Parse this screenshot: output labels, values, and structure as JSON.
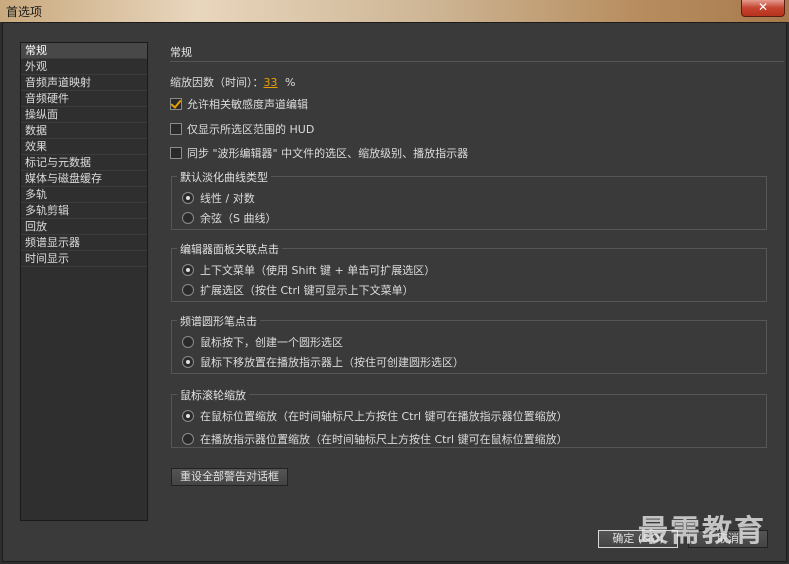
{
  "window": {
    "title": "首选项",
    "close_glyph": "✕"
  },
  "sidebar": {
    "items": [
      {
        "label": "常规"
      },
      {
        "label": "外观"
      },
      {
        "label": "音频声道映射"
      },
      {
        "label": "音频硬件"
      },
      {
        "label": "操纵面"
      },
      {
        "label": "数据"
      },
      {
        "label": "效果"
      },
      {
        "label": "标记与元数据"
      },
      {
        "label": "媒体与磁盘缓存"
      },
      {
        "label": "多轨"
      },
      {
        "label": "多轨剪辑"
      },
      {
        "label": "回放"
      },
      {
        "label": "频谱显示器"
      },
      {
        "label": "时间显示"
      }
    ],
    "selected_index": 0
  },
  "general": {
    "title": "常规",
    "zoom_label": "缩放因数（时间）：",
    "zoom_value": "33",
    "zoom_unit": "%",
    "checkboxes": [
      {
        "label": "允许相关敏感度声道编辑",
        "checked": true
      },
      {
        "label": "仅显示所选区范围的 HUD",
        "checked": false
      },
      {
        "label": "同步 \"波形编辑器\" 中文件的选区、缩放级别、播放指示器",
        "checked": false
      }
    ]
  },
  "groups": {
    "fade": {
      "title": "默认淡化曲线类型",
      "options": [
        {
          "label": "线性 / 对数",
          "checked": true
        },
        {
          "label": "余弦（S 曲线）",
          "checked": false
        }
      ]
    },
    "editor_click": {
      "title": "编辑器面板关联点击",
      "options": [
        {
          "label": "上下文菜单（使用 Shift 键 + 单击可扩展选区）",
          "checked": true
        },
        {
          "label": "扩展选区（按住 Ctrl 键可显示上下文菜单）",
          "checked": false
        }
      ]
    },
    "spectral_pen": {
      "title": "频谱圆形笔点击",
      "options": [
        {
          "label": "鼠标按下，创建一个圆形选区",
          "checked": false
        },
        {
          "label": "鼠标下移放置在播放指示器上（按住可创建圆形选区）",
          "checked": true
        }
      ]
    },
    "mouse_wheel": {
      "title": "鼠标滚轮缩放",
      "options": [
        {
          "label": "在鼠标位置缩放（在时间轴标尺上方按住 Ctrl 键可在播放指示器位置缩放）",
          "checked": true
        },
        {
          "label": "在播放指示器位置缩放（在时间轴标尺上方按住 Ctrl 键可在鼠标位置缩放）",
          "checked": false
        }
      ]
    }
  },
  "buttons": {
    "reset_warnings": "重设全部警告对话框",
    "ok": "确定 (&O)",
    "cancel": "取消"
  },
  "watermark": "最需教育"
}
